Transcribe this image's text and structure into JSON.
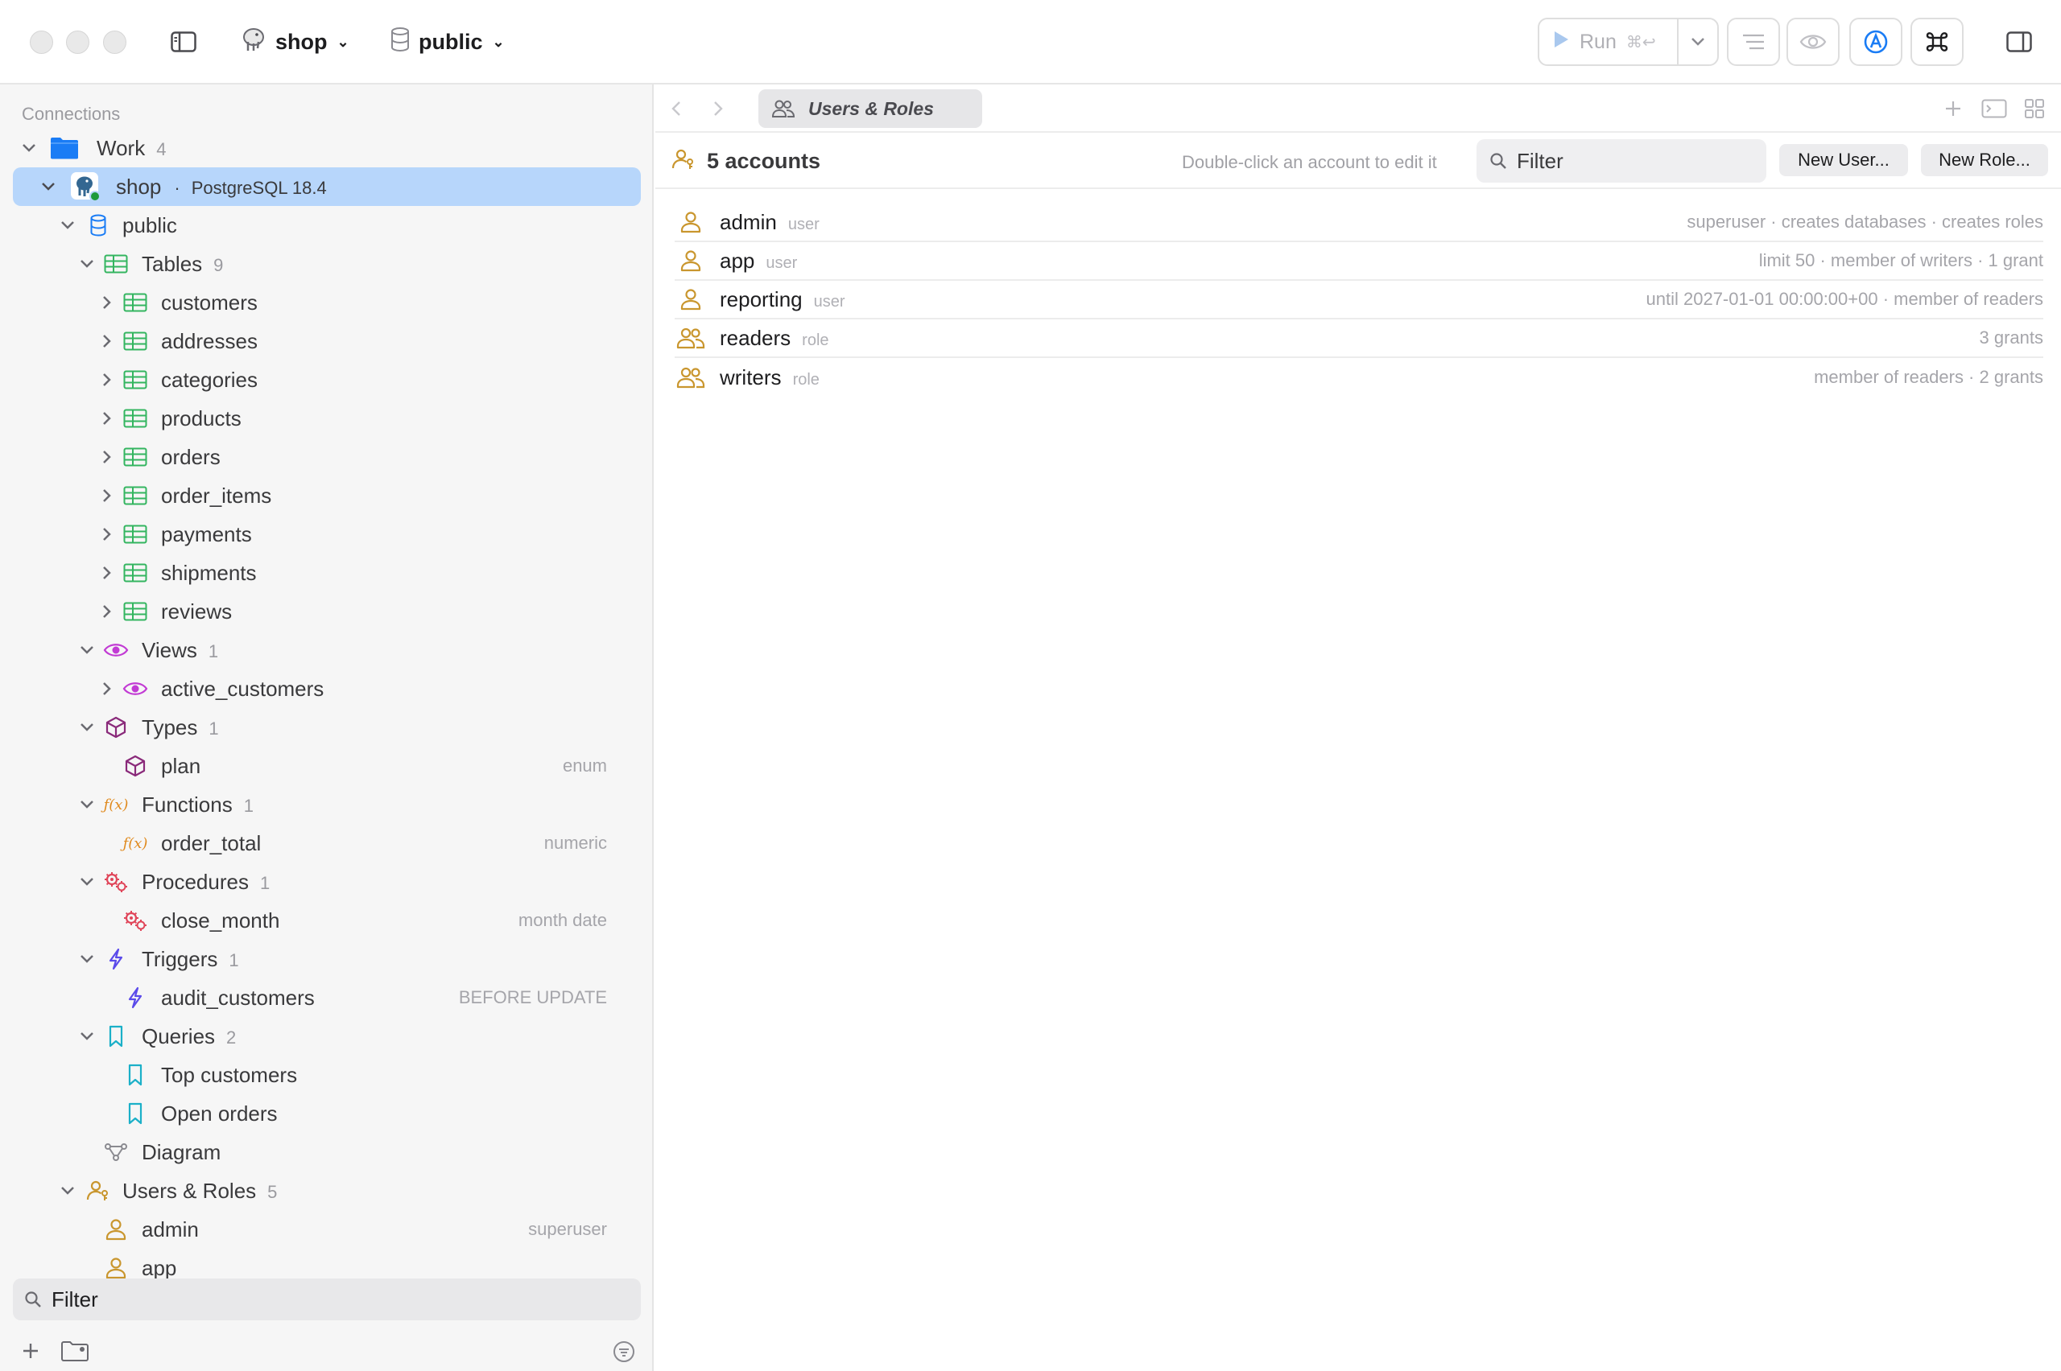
{
  "toolbar": {
    "connection_name": "shop",
    "schema_name": "public",
    "run_label": "Run",
    "run_shortcut": "⌘↩"
  },
  "sidebar": {
    "header": "Connections",
    "group": {
      "label": "Work",
      "count": "4"
    },
    "connection": {
      "label": "shop",
      "separator": "·",
      "version": "PostgreSQL 18.4"
    },
    "schema": {
      "label": "public"
    },
    "tables": {
      "label": "Tables",
      "count": "9",
      "items": [
        "customers",
        "addresses",
        "categories",
        "products",
        "orders",
        "order_items",
        "payments",
        "shipments",
        "reviews"
      ]
    },
    "views": {
      "label": "Views",
      "count": "1",
      "items": [
        "active_customers"
      ]
    },
    "types": {
      "label": "Types",
      "count": "1",
      "items": [
        {
          "label": "plan",
          "meta": "enum"
        }
      ]
    },
    "functions": {
      "label": "Functions",
      "count": "1",
      "items": [
        {
          "label": "order_total",
          "meta": "numeric"
        }
      ]
    },
    "procedures": {
      "label": "Procedures",
      "count": "1",
      "items": [
        {
          "label": "close_month",
          "meta": "month date"
        }
      ]
    },
    "triggers": {
      "label": "Triggers",
      "count": "1",
      "items": [
        {
          "label": "audit_customers",
          "meta": "BEFORE UPDATE"
        }
      ]
    },
    "queries": {
      "label": "Queries",
      "count": "2",
      "items": [
        "Top customers",
        "Open orders"
      ]
    },
    "diagram": {
      "label": "Diagram"
    },
    "users_roles": {
      "label": "Users & Roles",
      "count": "5",
      "items": [
        {
          "label": "admin",
          "meta": "superuser"
        },
        {
          "label": "app",
          "meta": ""
        }
      ]
    },
    "filter_placeholder": "Filter"
  },
  "main": {
    "tab_label": "Users & Roles",
    "account_count": "5 accounts",
    "hint": "Double-click an account to edit it",
    "filter_placeholder": "Filter",
    "new_user_label": "New User...",
    "new_role_label": "New Role...",
    "accounts": [
      {
        "name": "admin",
        "kind": "user",
        "desc": "superuser · creates databases · creates roles"
      },
      {
        "name": "app",
        "kind": "user",
        "desc": "limit 50 · member of writers · 1 grant"
      },
      {
        "name": "reporting",
        "kind": "user",
        "desc": "until 2027-01-01 00:00:00+00 · member of readers"
      },
      {
        "name": "readers",
        "kind": "role",
        "desc": "3 grants"
      },
      {
        "name": "writers",
        "kind": "role",
        "desc": "member of readers · 2 grants"
      }
    ]
  },
  "colors": {
    "accent_blue": "#1a7cf5",
    "table_green": "#34b560",
    "view_magenta": "#c23bd4",
    "type_purple": "#8a2a7a",
    "function_orange": "#e08a1e",
    "procedure_red": "#e0465a",
    "trigger_indigo": "#5b4bea",
    "query_cyan": "#1bb0c8",
    "user_gold": "#c9962e",
    "selection": "#b7d6fb"
  }
}
